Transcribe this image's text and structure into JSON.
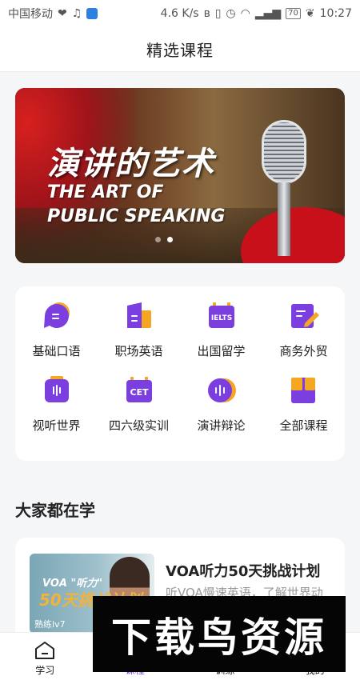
{
  "status_bar": {
    "carrier": "中国移动",
    "speed": "4.6 K/s",
    "battery": "70",
    "time": "10:27"
  },
  "header": {
    "title": "精选课程"
  },
  "banner": {
    "title_cn": "演讲的艺术",
    "title_en_line1": "THE ART OF",
    "title_en_line2": "PUBLIC SPEAKING",
    "page_count": 2,
    "active_page": 2
  },
  "categories": [
    {
      "label": "基础口语",
      "icon": "chat-bubble-icon"
    },
    {
      "label": "职场英语",
      "icon": "document-icon"
    },
    {
      "label": "出国留学",
      "icon": "ielts-icon",
      "icon_text": "IELTS"
    },
    {
      "label": "商务外贸",
      "icon": "edit-document-icon"
    },
    {
      "label": "视听世界",
      "icon": "audio-device-icon"
    },
    {
      "label": "四六级实训",
      "icon": "cet-icon",
      "icon_text": "CET"
    },
    {
      "label": "演讲辩论",
      "icon": "voice-icon"
    },
    {
      "label": "全部课程",
      "icon": "grid-icon"
    }
  ],
  "section": {
    "title": "大家都在学"
  },
  "course": {
    "title": "VOA听力50天挑战计划",
    "description": "听VOA慢速英语，了解世界动",
    "thumb_line1": "VOA \"听力\"",
    "thumb_line2": "50天挑战计划",
    "level": "熟练lv7"
  },
  "tabbar": [
    {
      "label": "学习",
      "icon": "home-icon",
      "active": false
    },
    {
      "label": "课程",
      "icon": "course-icon",
      "active": true
    },
    {
      "label": "训练",
      "icon": "training-icon",
      "active": false
    },
    {
      "label": "我的",
      "icon": "profile-icon",
      "active": false
    }
  ],
  "watermark": {
    "text": "下载鸟资源"
  },
  "colors": {
    "accent": "#7b3fe0",
    "accent_secondary": "#f5a623"
  }
}
